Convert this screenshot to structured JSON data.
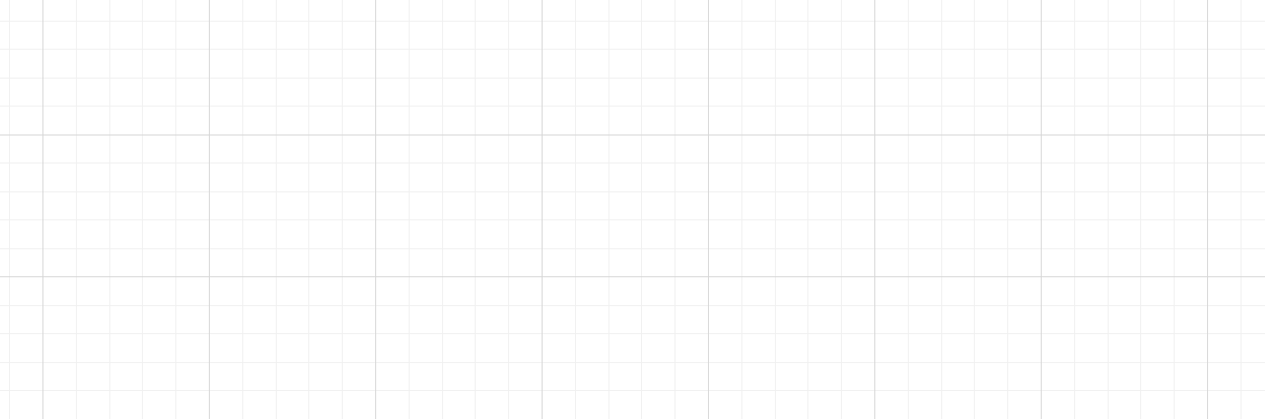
{
  "canvas": {
    "background": "#ffffff",
    "grid": {
      "visible": true,
      "style": "major-minor",
      "major_line_color": "#d6d6d6",
      "minor_line_color": "#f0f0f0",
      "minor_divisions_per_major": 5
    }
  }
}
